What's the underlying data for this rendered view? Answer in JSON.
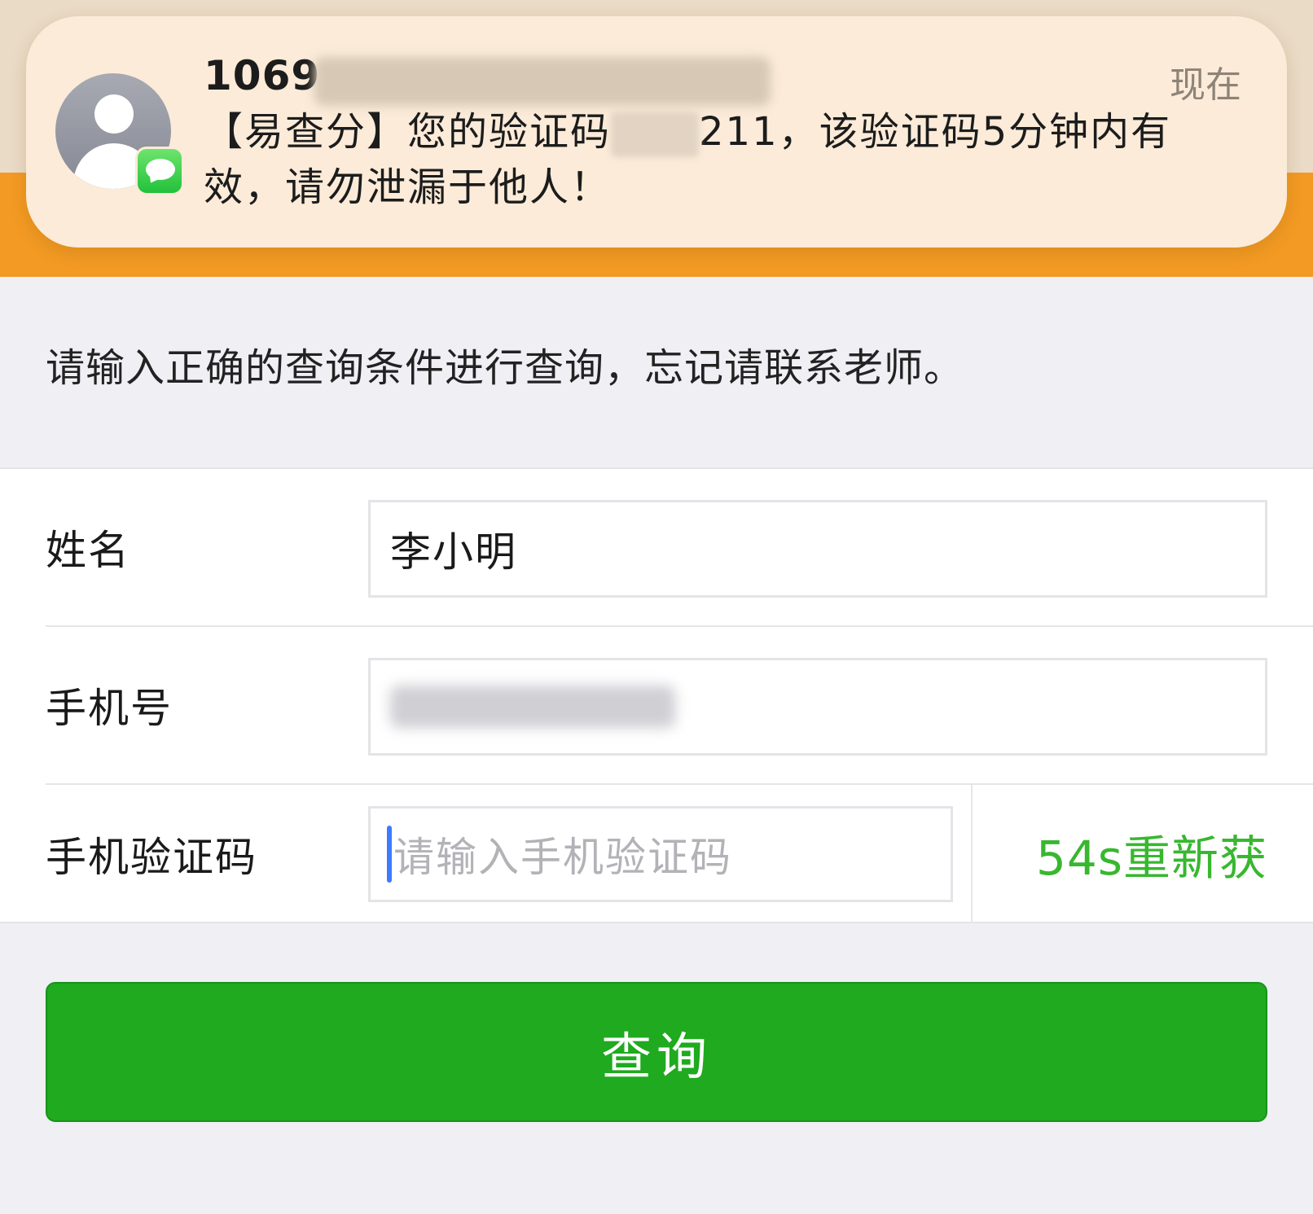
{
  "notification": {
    "sender_prefix": "1069",
    "time": "现在",
    "message_part1": "【易查分】您的验证码",
    "message_part2": "211，该验证码5分钟内有效，请勿泄漏于他人！",
    "app_icon": "messages-icon",
    "avatar_icon": "contact-avatar-icon"
  },
  "hint": "请输入正确的查询条件进行查询，忘记请联系老师。",
  "form": {
    "name_label": "姓名",
    "name_value": "李小明",
    "phone_label": "手机号",
    "code_label": "手机验证码",
    "code_placeholder": "请输入手机验证码",
    "resend_label": "54s重新获"
  },
  "query_button": "查询",
  "colors": {
    "accent_orange": "#f29a23",
    "button_green": "#1faa1f",
    "resend_green": "#38b72f",
    "caret_blue": "#3d7bff"
  }
}
